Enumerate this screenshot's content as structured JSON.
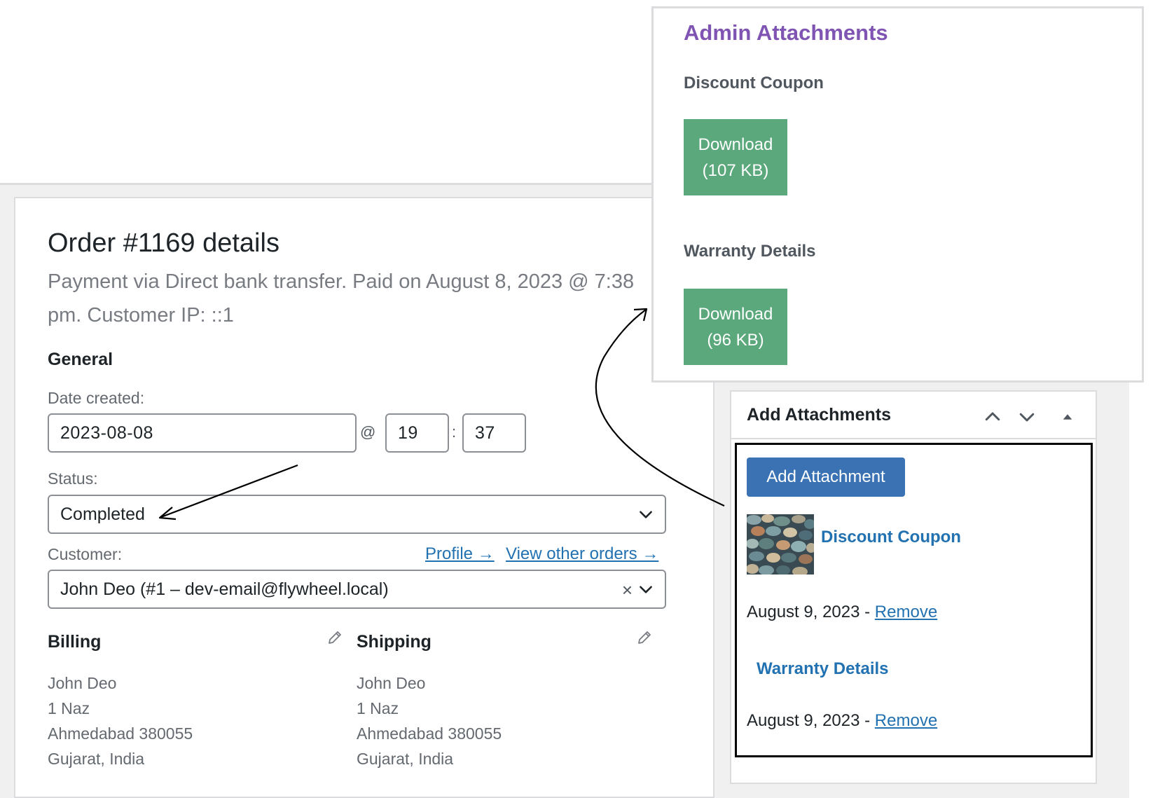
{
  "order": {
    "title": "Order #1169 details",
    "subtitle": "Payment via Direct bank transfer. Paid on August 8, 2023 @ 7:38 pm. Customer IP: ::1",
    "general_heading": "General",
    "date_label": "Date created:",
    "date_value": "2023-08-08",
    "at_sep": "@",
    "hour": "19",
    "colon_sep": ":",
    "minute": "37",
    "status_label": "Status:",
    "status_value": "Completed",
    "customer_label": "Customer:",
    "profile_link": "Profile →",
    "other_orders_link": "View other orders →",
    "customer_value": "John Deo (#1 – dev-email@flywheel.local)",
    "clear_icon": "×",
    "billing": {
      "heading": "Billing",
      "lines": [
        "John Deo",
        "1 Naz",
        "Ahmedabad 380055",
        "Gujarat, India"
      ]
    },
    "shipping": {
      "heading": "Shipping",
      "lines": [
        "John Deo",
        "1 Naz",
        "Ahmedabad 380055",
        "Gujarat, India"
      ]
    }
  },
  "add_attachments": {
    "title": "Add Attachments",
    "button": "Add Attachment",
    "items": [
      {
        "name": "Discount Coupon",
        "date": "August 9, 2023",
        "sep": " - ",
        "remove": "Remove"
      },
      {
        "name": "Warranty Details",
        "date": "August 9, 2023",
        "sep": " - ",
        "remove": "Remove"
      }
    ]
  },
  "admin_attachments": {
    "title": "Admin Attachments",
    "items": [
      {
        "name": "Discount Coupon",
        "button_line1": "Download",
        "button_line2": "(107 KB)"
      },
      {
        "name": "Warranty Details",
        "button_line1": "Download",
        "button_line2": "(96 KB)"
      }
    ]
  },
  "colors": {
    "link": "#2271b1",
    "primary_button": "#3a72b3",
    "download_button": "#5aa87b",
    "popup_title": "#7f54b3"
  },
  "icons": [
    "chevron-down-icon",
    "clear-icon",
    "pencil-icon",
    "chevron-up-icon",
    "triangle-up-icon"
  ]
}
